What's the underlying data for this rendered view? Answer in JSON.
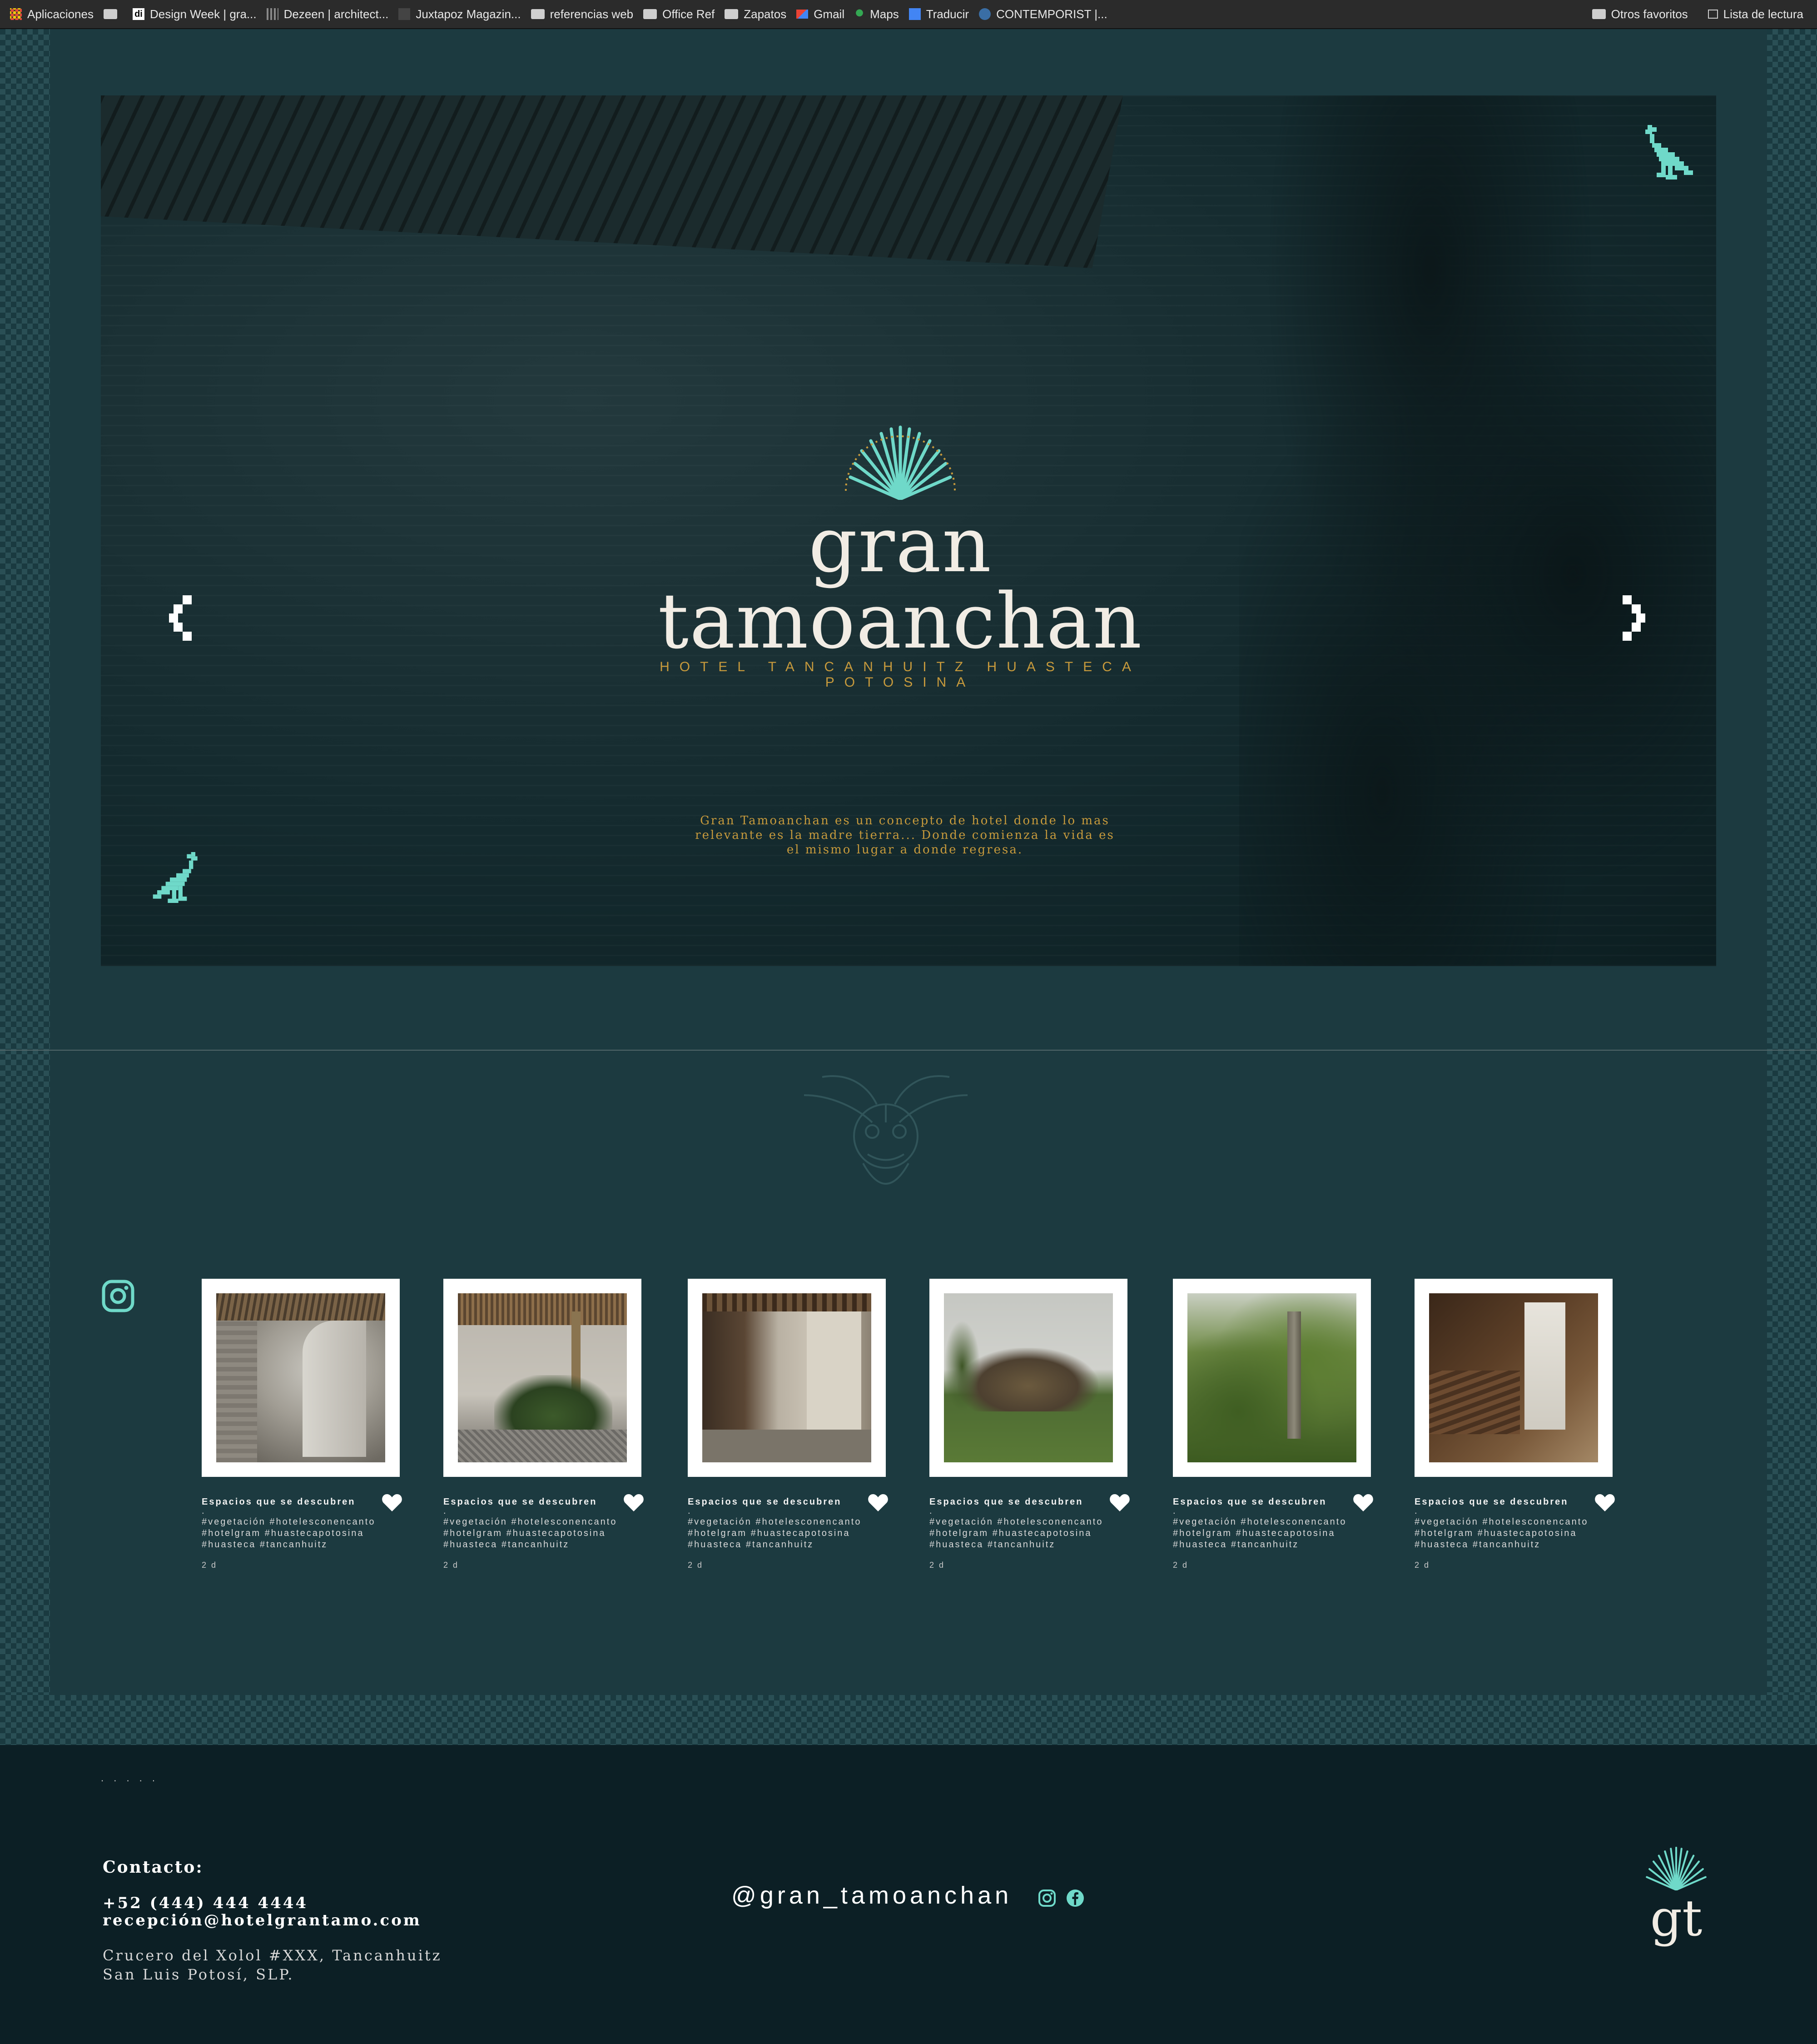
{
  "bookmarks": {
    "items": [
      {
        "label": "Aplicaciones",
        "icon": "apps-grid-icon"
      },
      {
        "label": "",
        "icon": "folder-icon"
      },
      {
        "label": "Design Week | gra...",
        "icon": "di-favicon"
      },
      {
        "label": "Dezeen | architect...",
        "icon": "dezeen-favicon"
      },
      {
        "label": "Juxtapoz Magazin...",
        "icon": "juxtapoz-favicon"
      },
      {
        "label": "referencias web",
        "icon": "folder-icon"
      },
      {
        "label": "Office Ref",
        "icon": "folder-icon"
      },
      {
        "label": "Zapatos",
        "icon": "folder-icon"
      },
      {
        "label": "Gmail",
        "icon": "gmail-icon"
      },
      {
        "label": "Maps",
        "icon": "maps-pin-icon"
      },
      {
        "label": "Traducir",
        "icon": "translate-icon"
      },
      {
        "label": "CONTEMPORIST |...",
        "icon": "contemporist-favicon"
      }
    ],
    "other_favorites": "Otros favoritos",
    "reading_list": "Lista de lectura"
  },
  "hero": {
    "brand": "gran tamoanchan",
    "tagline": "HOTEL TANCANHUITZ HUASTECA POTOSINA",
    "description": "Gran Tamoanchan es un concepto de hotel donde lo mas relevante es la madre tierra... Donde comienza la vida es el mismo lugar a donde regresa.",
    "prev_icon": "chevron-left-icon",
    "next_icon": "chevron-right-icon",
    "accent_color": "#6fd9c9",
    "gold_color": "#c79a3c"
  },
  "instagram": {
    "icon": "instagram-icon",
    "posts": [
      {
        "title": "Espacios que se descubren",
        "dot": ".",
        "tags": "#vegetación #hotelesconencanto #hotelgram #huastecapotosina #huasteca #tancanhuitz",
        "time": "2 d"
      },
      {
        "title": "Espacios que se descubren",
        "dot": ".",
        "tags": "#vegetación #hotelesconencanto #hotelgram #huastecapotosina #huasteca #tancanhuitz",
        "time": "2 d"
      },
      {
        "title": "Espacios que se descubren",
        "dot": ".",
        "tags": "#vegetación #hotelesconencanto #hotelgram #huastecapotosina #huasteca #tancanhuitz",
        "time": "2 d"
      },
      {
        "title": "Espacios que se descubren",
        "dot": ".",
        "tags": "#vegetación #hotelesconencanto #hotelgram #huastecapotosina #huasteca #tancanhuitz",
        "time": "2 d"
      },
      {
        "title": "Espacios que se descubren",
        "dot": ".",
        "tags": "#vegetación #hotelesconencanto #hotelgram #huastecapotosina #huasteca #tancanhuitz",
        "time": "2 d"
      },
      {
        "title": "Espacios que se descubren",
        "dot": ".",
        "tags": "#vegetación #hotelesconencanto #hotelgram #huastecapotosina #huasteca #tancanhuitz",
        "time": "2 d"
      }
    ]
  },
  "footer": {
    "dots": ". . . . .",
    "contact_label": "Contacto:",
    "phone": "+52 (444) 444 4444",
    "email": "recepción@hotelgrantamo.com",
    "address_line1": "Crucero del Xolol #XXX, Tancanhuitz",
    "address_line2": "San Luis Potosí, SLP.",
    "handle": "@gran_tamoanchan",
    "social_icons": [
      "instagram-icon",
      "facebook-icon"
    ],
    "logo_monogram": "gt",
    "accent_color": "#6fd9c9"
  }
}
